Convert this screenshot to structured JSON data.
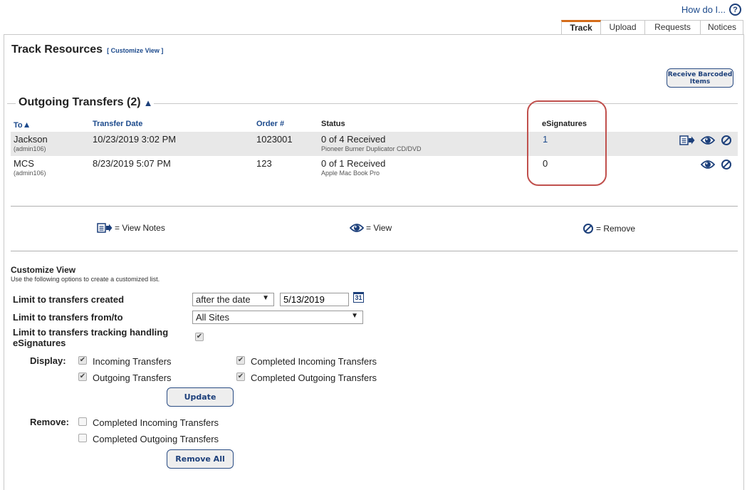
{
  "header": {
    "help_link": "How do I...",
    "help_icon": "question-circle-icon",
    "tabs": [
      {
        "label": "Track",
        "active": true
      },
      {
        "label": "Upload",
        "active": false
      },
      {
        "label": "Requests",
        "active": false
      },
      {
        "label": "Notices",
        "active": false
      }
    ]
  },
  "page": {
    "title": "Track Resources",
    "customize_link": "[ Customize View ]",
    "receive_button": "Receive Barcoded Items",
    "receive_button_line1": "Receive Barcoded",
    "receive_button_line2": "Items"
  },
  "outgoing": {
    "section_title": "Outgoing Transfers (2)",
    "sort_icon": "▲",
    "columns": {
      "to": "To",
      "to_sort": "▲",
      "date": "Transfer Date",
      "order": "Order #",
      "status": "Status",
      "esignatures": "eSignatures"
    },
    "rows": [
      {
        "to": "Jackson",
        "to_sub": "(admin106)",
        "date": "10/23/2019 3:02 PM",
        "order": "1023001",
        "status": "0 of 4 Received",
        "status_sub": "Pioneer Burner Duplicator CD/DVD",
        "esignatures": "1",
        "actions": [
          "view-notes",
          "view",
          "remove"
        ]
      },
      {
        "to": "MCS",
        "to_sub": "(admin106)",
        "date": "8/23/2019 5:07 PM",
        "order": "123",
        "status": "0 of 1 Received",
        "status_sub": "Apple Mac Book Pro",
        "esignatures": "0",
        "actions": [
          "view",
          "remove"
        ]
      }
    ]
  },
  "legend": {
    "view_notes": "= View Notes",
    "view": "= View",
    "remove": "= Remove"
  },
  "customize": {
    "title": "Customize View",
    "subtitle": "Use the following options to create a customized list.",
    "created_label": "Limit to transfers created",
    "created_select": "after the date",
    "created_date": "5/13/2019",
    "calendar_icon_text": "31",
    "fromto_label": "Limit to transfers from/to",
    "fromto_select": "All Sites",
    "esig_label_line1": "Limit to transfers tracking handling",
    "esig_label_line2": "eSignatures",
    "esig_checked": true,
    "display_label": "Display:",
    "display_options": [
      {
        "label": "Incoming Transfers",
        "checked": true
      },
      {
        "label": "Outgoing Transfers",
        "checked": true
      },
      {
        "label": "Completed Incoming Transfers",
        "checked": true
      },
      {
        "label": "Completed Outgoing Transfers",
        "checked": true
      }
    ],
    "update_button": "Update",
    "remove_label": "Remove:",
    "remove_options": [
      {
        "label": "Completed Incoming Transfers",
        "checked": false
      },
      {
        "label": "Completed Outgoing Transfers",
        "checked": false
      }
    ],
    "remove_all_button": "Remove All"
  },
  "colors": {
    "accent_tab": "#d46c1a",
    "link_blue": "#1c4a8c",
    "highlight_red": "#c0504d",
    "row_shade": "#e8e8e8"
  }
}
